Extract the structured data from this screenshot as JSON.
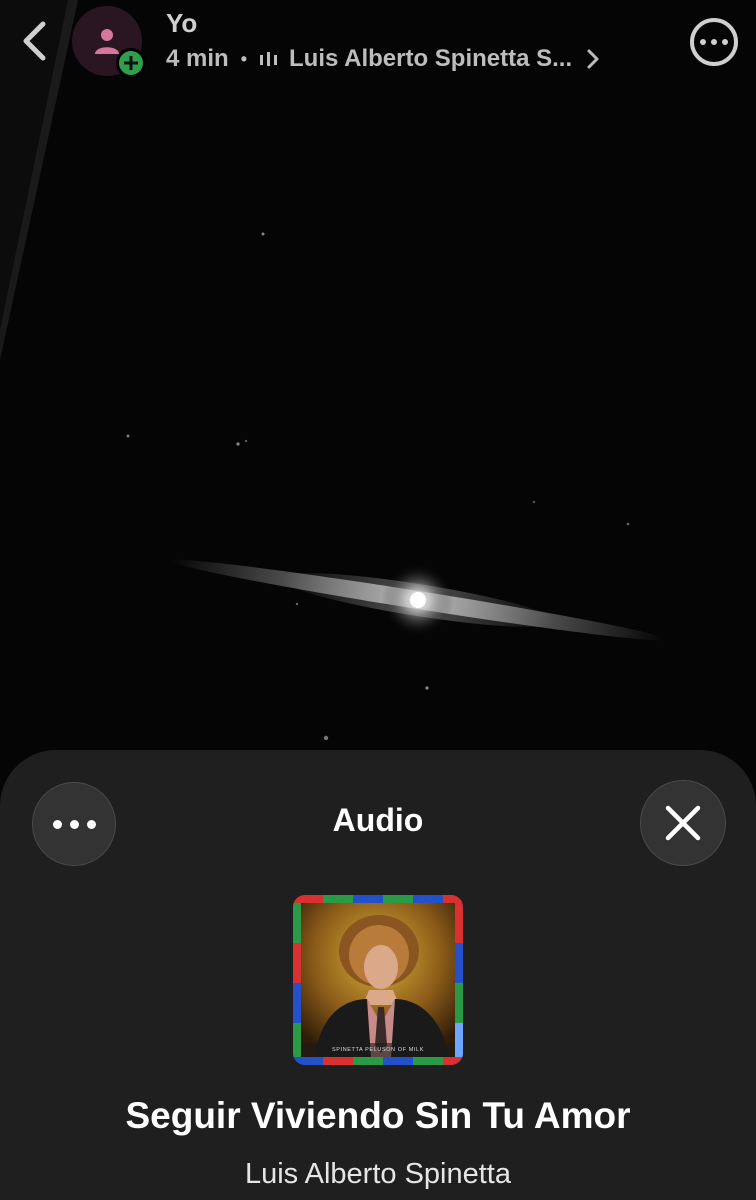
{
  "header": {
    "user_name": "Yo",
    "time_ago": "4 min",
    "separator": "•",
    "song_link_text": "Luis Alberto Spinetta S..."
  },
  "audio_sheet": {
    "title": "Audio",
    "track_title": "Seguir Viviendo Sin Tu Amor",
    "track_artist": "Luis Alberto Spinetta",
    "album_cover_text": "SPINETTA  PELUSON OF MILK"
  },
  "colors": {
    "sheet_background": "#1f1f1f",
    "button_background": "#333333",
    "avatar_plus_badge": "#2f9e4f",
    "avatar_icon": "#d5779a"
  },
  "icons": [
    "chevron-left-icon",
    "person-icon",
    "plus-icon",
    "audio-bars-icon",
    "chevron-right-icon",
    "more-horizontal-icon",
    "close-icon"
  ]
}
